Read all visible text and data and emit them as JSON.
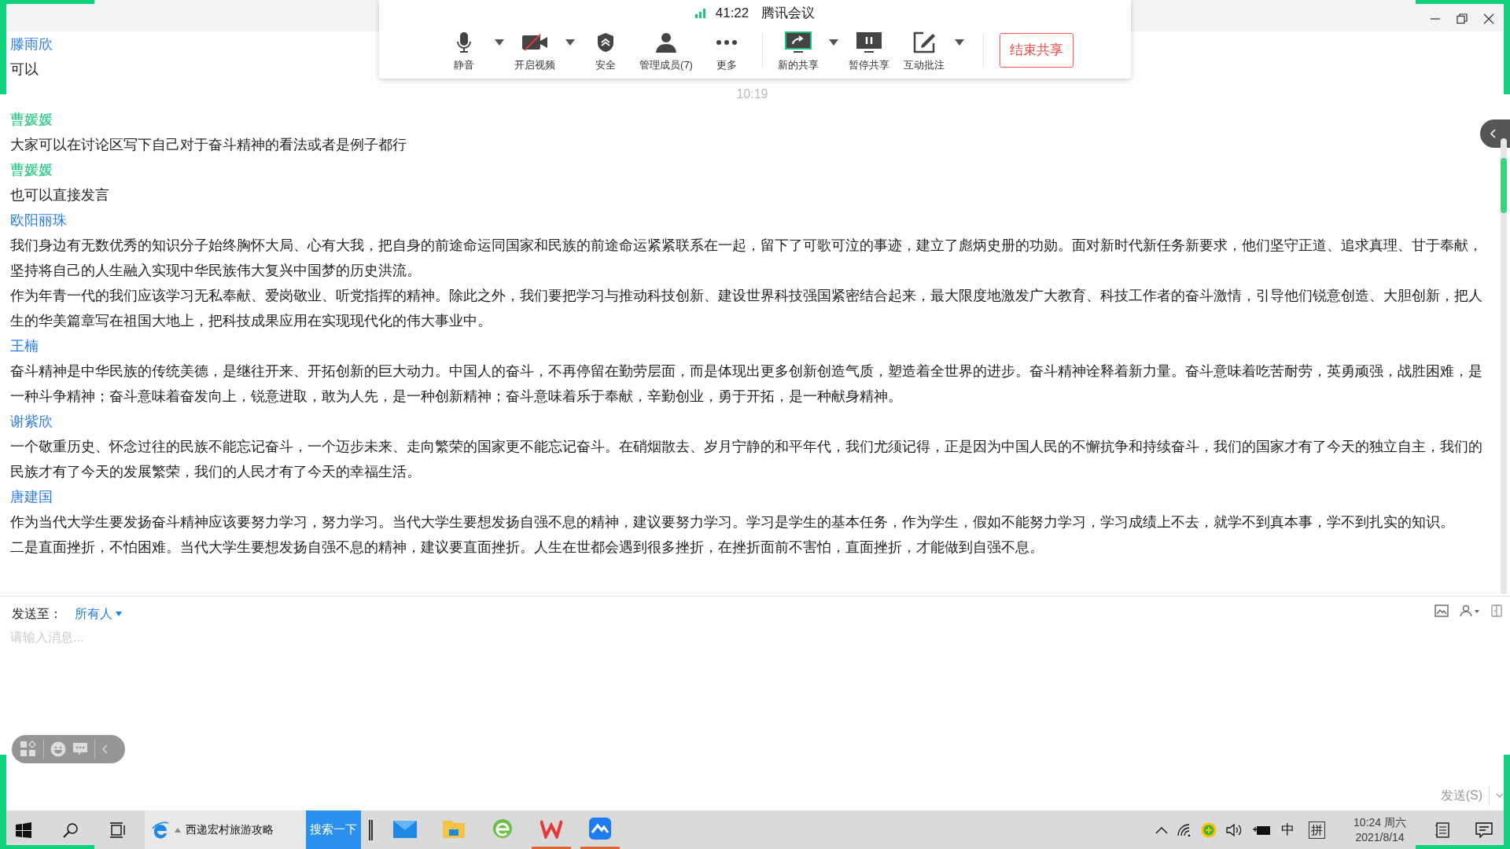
{
  "meeting_toolbar": {
    "duration": "41:22",
    "app_name": "腾讯会议",
    "buttons": [
      {
        "label": "静音",
        "kind": "mic",
        "has_menu": true
      },
      {
        "label": "开启视频",
        "kind": "video",
        "has_menu": true
      },
      {
        "label": "安全",
        "kind": "shield",
        "has_menu": false
      },
      {
        "label": "管理成员(7)",
        "kind": "members",
        "has_menu": false
      },
      {
        "label": "更多",
        "kind": "more",
        "has_menu": false
      },
      {
        "label": "新的共享",
        "kind": "share",
        "has_menu": true
      },
      {
        "label": "暂停共享",
        "kind": "pause",
        "has_menu": false
      },
      {
        "label": "互动批注",
        "kind": "annotate",
        "has_menu": true
      }
    ],
    "end_button": "结束共享"
  },
  "chat": {
    "entries": [
      {
        "kind": "message",
        "sender": "滕雨欣",
        "color": "#2b7de9",
        "paragraphs": [
          "可以"
        ]
      },
      {
        "kind": "time",
        "text": "10:19"
      },
      {
        "kind": "message",
        "sender": "曹媛媛",
        "color": "#1cc47d",
        "paragraphs": [
          "大家可以在讨论区写下自己对于奋斗精神的看法或者是例子都行"
        ]
      },
      {
        "kind": "message",
        "sender": "曹媛媛",
        "color": "#1cc47d",
        "paragraphs": [
          "也可以直接发言"
        ]
      },
      {
        "kind": "message",
        "sender": "欧阳丽珠",
        "color": "#2b7de9",
        "paragraphs": [
          "我们身边有无数优秀的知识分子始终胸怀大局、心有大我，把自身的前途命运同国家和民族的前途命运紧紧联系在一起，留下了可歌可泣的事迹，建立了彪炳史册的功勋。面对新时代新任务新要求，他们坚守正道、追求真理、甘于奉献，坚持将自己的人生融入实现中华民族伟大复兴中国梦的历史洪流。",
          "作为年青一代的我们应该学习无私奉献、爱岗敬业、听党指挥的精神。除此之外，我们要把学习与推动科技创新、建设世界科技强国紧密结合起来，最大限度地激发广大教育、科技工作者的奋斗激情，引导他们锐意创造、大胆创新，把人生的华美篇章写在祖国大地上，把科技成果应用在实现现代化的伟大事业中。"
        ]
      },
      {
        "kind": "message",
        "sender": "王楠",
        "color": "#2b7de9",
        "paragraphs": [
          "奋斗精神是中华民族的传统美德，是继往开来、开拓创新的巨大动力。中国人的奋斗，不再停留在勤劳层面，而是体现出更多创新创造气质，塑造着全世界的进步。奋斗精神诠释着新力量。奋斗意味着吃苦耐劳，英勇顽强，战胜困难，是一种斗争精神；奋斗意味着奋发向上，锐意进取，敢为人先，是一种创新精神；奋斗意味着乐于奉献，辛勤创业，勇于开拓，是一种献身精神。"
        ]
      },
      {
        "kind": "message",
        "sender": "谢紫欣",
        "color": "#2b7de9",
        "paragraphs": [
          "一个敬重历史、怀念过往的民族不能忘记奋斗，一个迈步未来、走向繁荣的国家更不能忘记奋斗。在硝烟散去、岁月宁静的和平年代，我们尤须记得，正是因为中国人民的不懈抗争和持续奋斗，我们的国家才有了今天的独立自主，我们的民族才有了今天的发展繁荣，我们的人民才有了今天的幸福生活。"
        ]
      },
      {
        "kind": "message",
        "sender": "唐建国",
        "color": "#2b7de9",
        "paragraphs": [
          "作为当代大学生要发扬奋斗精神应该要努力学习，努力学习。当代大学生要想发扬自强不息的精神，建议要努力学习。学习是学生的基本任务，作为学生，假如不能努力学习，学习成绩上不去，就学不到真本事，学不到扎实的知识。",
          "二是直面挫折，不怕困难。当代大学生要想发扬自强不息的精神，建议要直面挫折。人生在世都会遇到很多挫折，在挫折面前不害怕，直面挫折，才能做到自强不息。"
        ]
      }
    ]
  },
  "composer": {
    "send_to_label": "发送至：",
    "recipient": "所有人",
    "placeholder": "请输入消息...",
    "send_button": "发送(S)"
  },
  "taskbar": {
    "search_text": "西递宏村旅游攻略",
    "search_button": "搜索一下",
    "apps": [
      {
        "kind": "mail",
        "running": false
      },
      {
        "kind": "folder",
        "running": false
      },
      {
        "kind": "browser",
        "running": false
      },
      {
        "kind": "wps",
        "running": true
      },
      {
        "kind": "meeting",
        "running": true
      }
    ],
    "ime_mode": "中",
    "ime_name": "拼",
    "time": "10:24 周六",
    "date": "2021/8/14"
  }
}
